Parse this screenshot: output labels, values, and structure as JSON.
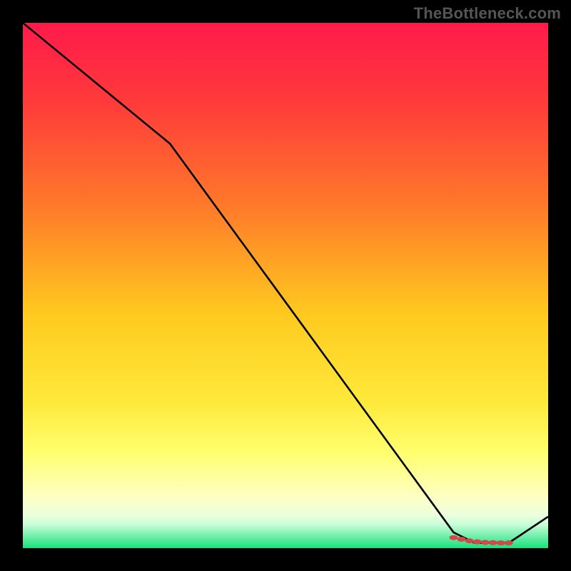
{
  "attribution": "TheBottleneck.com",
  "chart_data": {
    "type": "line",
    "title": "",
    "xlabel": "",
    "ylabel": "",
    "xlim": [
      0,
      100
    ],
    "ylim": [
      0,
      100
    ],
    "x": [
      0,
      28,
      82,
      86,
      92.5,
      100
    ],
    "values": [
      100,
      77,
      3,
      1,
      1,
      6
    ],
    "dots": {
      "x": [
        82,
        83.5,
        85,
        86.5,
        88,
        89.5,
        91,
        92.5
      ],
      "y": [
        2.0,
        1.7,
        1.4,
        1.2,
        1.1,
        1.05,
        1.0,
        1.0
      ]
    },
    "gradient_stops": [
      {
        "offset": 0.0,
        "color": "#ff1a4b"
      },
      {
        "offset": 0.15,
        "color": "#ff3a3a"
      },
      {
        "offset": 0.35,
        "color": "#ff7a2a"
      },
      {
        "offset": 0.55,
        "color": "#ffc81f"
      },
      {
        "offset": 0.72,
        "color": "#ffe93a"
      },
      {
        "offset": 0.82,
        "color": "#ffff70"
      },
      {
        "offset": 0.9,
        "color": "#fdffc0"
      },
      {
        "offset": 0.935,
        "color": "#eeffdd"
      },
      {
        "offset": 0.955,
        "color": "#c8ffd8"
      },
      {
        "offset": 0.975,
        "color": "#7af0b0"
      },
      {
        "offset": 1.0,
        "color": "#18e07a"
      }
    ],
    "colors": {
      "line": "#000000",
      "dots": "#d04a4a",
      "frame_bg": "#000000"
    }
  }
}
